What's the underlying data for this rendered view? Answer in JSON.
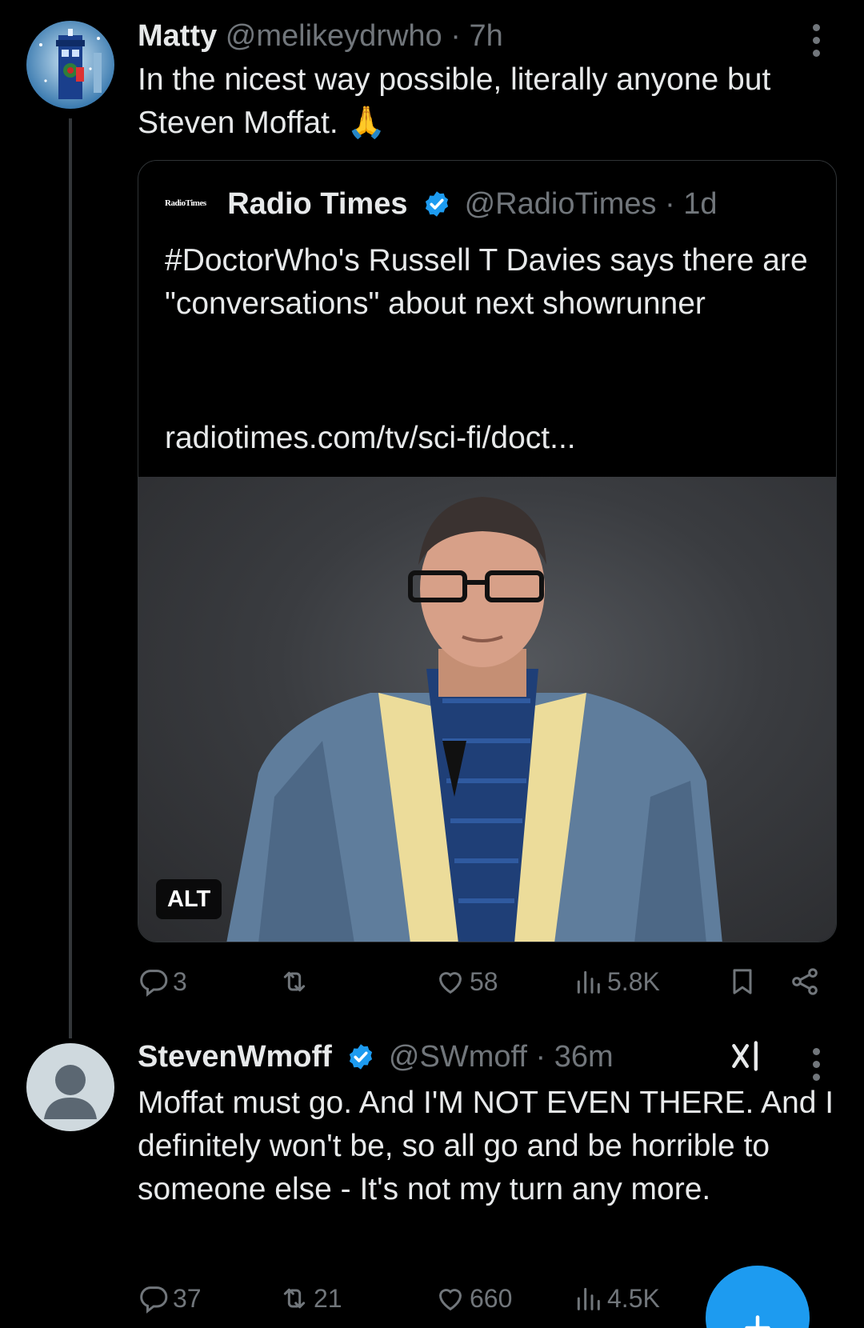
{
  "tweet1": {
    "author_name": "Matty",
    "handle": "@melikeydrwho",
    "separator": "·",
    "time": "7h",
    "text": "In the nicest way possible, literally anyone but Steven Moffat. 🙏",
    "quote": {
      "logo_text": "RadioTimes",
      "author_name": "Radio Times",
      "handle": "@RadioTimes",
      "separator": "·",
      "time": "1d",
      "text": "#DoctorWho's Russell T Davies says there are \"conversations\" about next showrunner",
      "link": "radiotimes.com/tv/sci-fi/doct...",
      "alt_label": "ALT"
    },
    "actions": {
      "replies": "3",
      "reposts": "",
      "likes": "58",
      "views": "5.8K"
    }
  },
  "tweet2": {
    "author_name": "StevenWmoff",
    "handle": "@SWmoff",
    "separator": "·",
    "time": "36m",
    "text": "Moffat must go. And I'M NOT EVEN THERE. And I definitely won't be, so all go and be horrible to someone else - It's not my turn any more.",
    "actions": {
      "replies": "37",
      "reposts": "21",
      "likes": "660",
      "views": "4.5K"
    }
  },
  "colors": {
    "background": "#000000",
    "text": "#e7e9ea",
    "muted": "#71767b",
    "accent": "#1d9bf0",
    "border": "#2f3336"
  },
  "icons": [
    "tardis-avatar",
    "verified-badge",
    "more-icon",
    "reply-icon",
    "repost-icon",
    "like-icon",
    "views-icon",
    "bookmark-icon",
    "share-icon",
    "grok-icon",
    "default-avatar",
    "compose-icon"
  ]
}
